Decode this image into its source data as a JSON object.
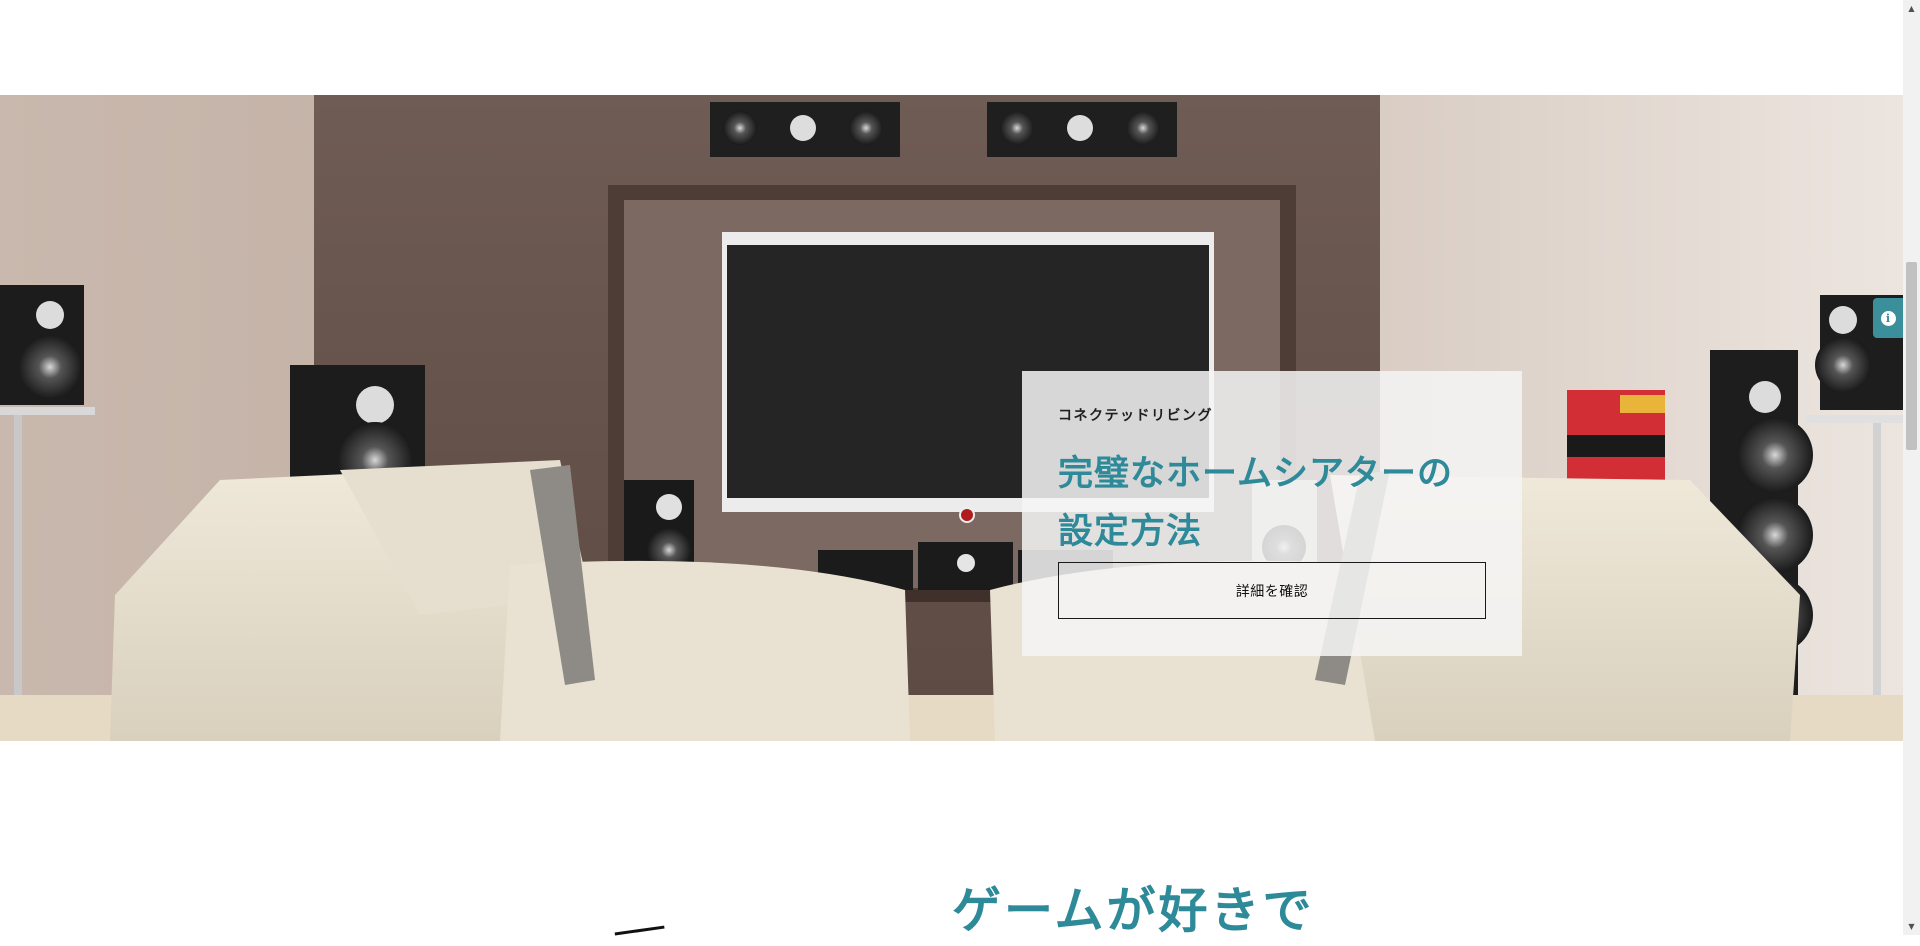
{
  "hero": {
    "eyebrow": "コネクテッドリビング",
    "headline_line1": "完璧なホームシアターの",
    "headline_line2": "設定方法",
    "cta_label": "詳細を確認",
    "image_icon": "home-theater-photo"
  },
  "info_tab": {
    "icon": "info-icon",
    "glyph": "i"
  },
  "next_section": {
    "heading": "ゲームが好きで"
  },
  "scrollbar": {
    "up_glyph": "▲",
    "down_glyph": "▼"
  },
  "colors": {
    "accent": "#2e8a99",
    "card_bg": "#f4f4f4",
    "info_tab": "#3a8f9b"
  }
}
